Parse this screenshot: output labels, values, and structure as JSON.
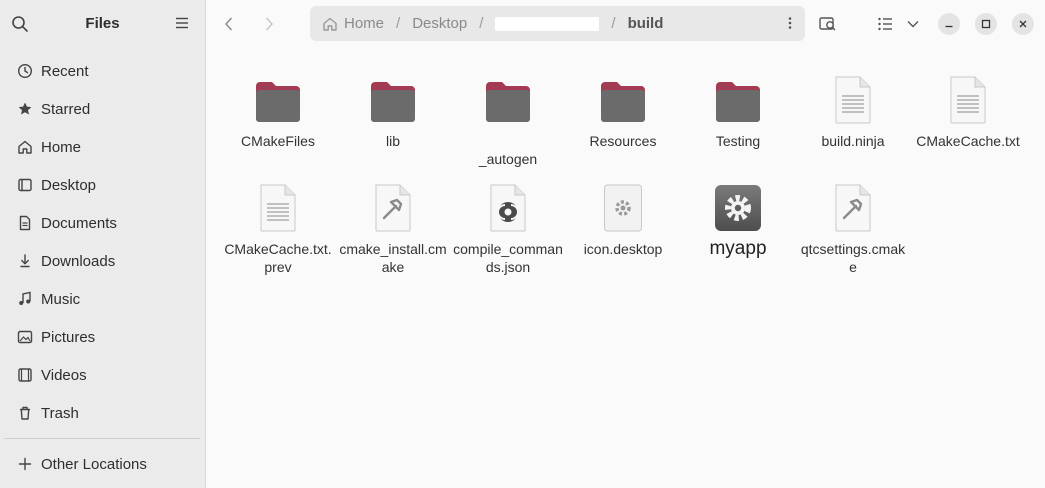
{
  "sidebar": {
    "title": "Files",
    "items": [
      {
        "label": "Recent",
        "icon": "clock-icon"
      },
      {
        "label": "Starred",
        "icon": "star-icon"
      },
      {
        "label": "Home",
        "icon": "home-icon"
      },
      {
        "label": "Desktop",
        "icon": "desktop-icon"
      },
      {
        "label": "Documents",
        "icon": "document-icon"
      },
      {
        "label": "Downloads",
        "icon": "download-icon"
      },
      {
        "label": "Music",
        "icon": "music-icon"
      },
      {
        "label": "Pictures",
        "icon": "pictures-icon"
      },
      {
        "label": "Videos",
        "icon": "video-icon"
      },
      {
        "label": "Trash",
        "icon": "trash-icon"
      }
    ],
    "other": {
      "label": "Other Locations",
      "icon": "plus-icon"
    }
  },
  "pathbar": {
    "crumbs": [
      "Home",
      "Desktop",
      "",
      "build"
    ],
    "separator": "/"
  },
  "files": [
    {
      "name": "CMakeFiles",
      "type": "folder"
    },
    {
      "name": "lib",
      "type": "folder"
    },
    {
      "name": "_autogen",
      "type": "folder"
    },
    {
      "name": "Resources",
      "type": "folder"
    },
    {
      "name": "Testing",
      "type": "folder"
    },
    {
      "name": "build.ninja",
      "type": "text"
    },
    {
      "name": "CMakeCache.txt",
      "type": "text"
    },
    {
      "name": "CMakeCache.txt.prev",
      "type": "text"
    },
    {
      "name": "cmake_install.cmake",
      "type": "script"
    },
    {
      "name": "compile_commands.json",
      "type": "json"
    },
    {
      "name": "icon.desktop",
      "type": "desktop"
    },
    {
      "name": "myapp",
      "type": "executable"
    },
    {
      "name": "qtcsettings.cmake",
      "type": "script"
    }
  ],
  "colors": {
    "folder_tab": "#a33b52",
    "folder_body": "#6b6b6b",
    "sidebar_bg": "#ebebeb",
    "content_bg": "#fafafa"
  }
}
